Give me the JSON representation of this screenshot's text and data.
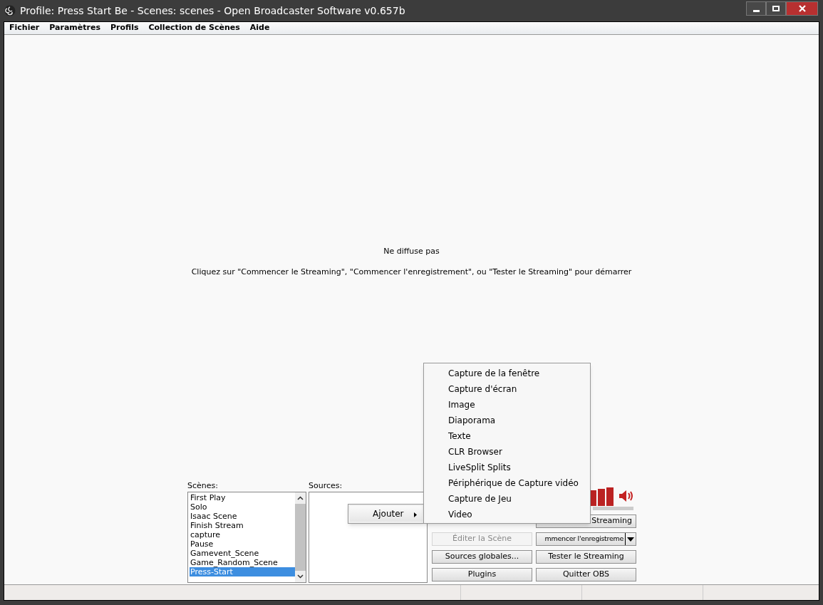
{
  "window": {
    "title": "Profile: Press Start Be - Scenes: scenes - Open Broadcaster Software v0.657b"
  },
  "menu_bar": [
    "Fichier",
    "Paramètres",
    "Profils",
    "Collection de Scènes",
    "Aide"
  ],
  "preview": {
    "status": "Ne diffuse pas",
    "hint": "Cliquez sur \"Commencer le Streaming\", \"Commencer l'enregistrement\", ou \"Tester le Streaming\" pour démarrer"
  },
  "scenes": {
    "label": "Scènes:",
    "items": [
      {
        "name": "First Play",
        "selected": false
      },
      {
        "name": "Solo",
        "selected": false
      },
      {
        "name": "Isaac Scene",
        "selected": false
      },
      {
        "name": "Finish Stream",
        "selected": false
      },
      {
        "name": "capture",
        "selected": false
      },
      {
        "name": "Pause",
        "selected": false
      },
      {
        "name": "Gamevent_Scene",
        "selected": false
      },
      {
        "name": "Game_Random_Scene",
        "selected": false
      },
      {
        "name": "Press-Start",
        "selected": true
      }
    ]
  },
  "sources": {
    "label": "Sources:"
  },
  "volume": {
    "level": 1
  },
  "buttons": [
    {
      "label": "Streaming",
      "kind": "button",
      "disabled": false
    },
    {
      "label": "Éditer la Scène",
      "kind": "button",
      "disabled": true
    },
    {
      "label": "mmencer l'enregistreme",
      "kind": "dropdown",
      "disabled": false
    },
    {
      "label": "Sources globales...",
      "kind": "button",
      "disabled": false
    },
    {
      "label": "Tester le Streaming",
      "kind": "button",
      "disabled": false
    },
    {
      "label": "Plugins",
      "kind": "button",
      "disabled": false
    },
    {
      "label": "Quitter OBS",
      "kind": "button",
      "disabled": false
    }
  ],
  "context_menu": {
    "label": "Ajouter",
    "submenu": [
      "Capture de la fenêtre",
      "Capture d'écran",
      "Image",
      "Diaporama",
      "Texte",
      "CLR Browser",
      "LiveSplit Splits",
      "Périphérique de Capture vidéo",
      "Capture de Jeu",
      "Video"
    ]
  }
}
